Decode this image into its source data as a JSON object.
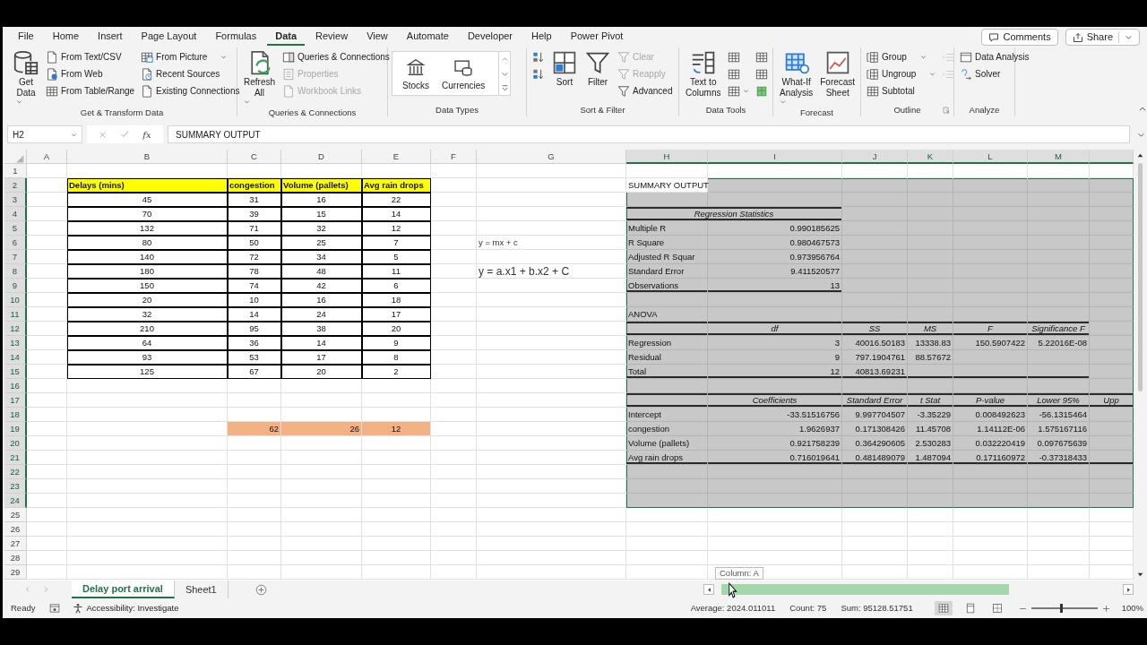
{
  "ribbon_tabs": [
    {
      "label": "File",
      "selected": false
    },
    {
      "label": "Home",
      "selected": false
    },
    {
      "label": "Insert",
      "selected": false
    },
    {
      "label": "Page Layout",
      "selected": false
    },
    {
      "label": "Formulas",
      "selected": false
    },
    {
      "label": "Data",
      "selected": true
    },
    {
      "label": "Review",
      "selected": false
    },
    {
      "label": "View",
      "selected": false
    },
    {
      "label": "Automate",
      "selected": false
    },
    {
      "label": "Developer",
      "selected": false
    },
    {
      "label": "Help",
      "selected": false
    },
    {
      "label": "Power Pivot",
      "selected": false
    }
  ],
  "header_buttons": [
    {
      "label": "Comments",
      "dropdown": false
    },
    {
      "label": "Share",
      "dropdown": true
    }
  ],
  "ribbon_groups": [
    {
      "label": "Get & Transform Data",
      "launcher": false,
      "columns": [
        {
          "kind": "large",
          "items": [
            {
              "label": "Get\nData",
              "disabled": false,
              "dropdown": true
            }
          ]
        },
        {
          "kind": "small",
          "items": [
            {
              "label": "From Text/CSV",
              "disabled": false,
              "dropdown": false
            },
            {
              "label": "From Web",
              "disabled": false,
              "dropdown": false
            },
            {
              "label": "From Table/Range",
              "disabled": false,
              "dropdown": false
            }
          ]
        },
        {
          "kind": "small",
          "items": [
            {
              "label": "From Picture",
              "disabled": false,
              "dropdown": true
            },
            {
              "label": "Recent Sources",
              "disabled": false,
              "dropdown": false
            },
            {
              "label": "Existing Connections",
              "disabled": false,
              "dropdown": false
            }
          ]
        }
      ]
    },
    {
      "label": "Queries & Connections",
      "launcher": false,
      "columns": [
        {
          "kind": "large",
          "items": [
            {
              "label": "Refresh\nAll",
              "disabled": false,
              "dropdown": true
            }
          ]
        },
        {
          "kind": "small",
          "items": [
            {
              "label": "Queries & Connections",
              "disabled": false,
              "dropdown": false
            },
            {
              "label": "Properties",
              "disabled": true,
              "dropdown": false
            },
            {
              "label": "Workbook Links",
              "disabled": true,
              "dropdown": false
            }
          ]
        }
      ]
    },
    {
      "label": "Data Types",
      "launcher": false,
      "columns": [
        {
          "kind": "gallery",
          "items": [
            {
              "label": "Stocks",
              "disabled": false,
              "dropdown": false
            },
            {
              "label": "Currencies",
              "disabled": false,
              "dropdown": false
            }
          ]
        }
      ]
    },
    {
      "label": "Sort & Filter",
      "launcher": false,
      "columns": [
        {
          "kind": "small",
          "items": [
            {
              "disabled": false,
              "dropdown": false
            },
            {
              "disabled": false,
              "dropdown": false
            }
          ]
        },
        {
          "kind": "large",
          "items": [
            {
              "label": "Sort",
              "disabled": false,
              "dropdown": false
            }
          ]
        },
        {
          "kind": "large",
          "items": [
            {
              "label": "Filter",
              "disabled": false,
              "dropdown": false
            }
          ]
        },
        {
          "kind": "small",
          "items": [
            {
              "label": "Clear",
              "disabled": true,
              "dropdown": false
            },
            {
              "label": "Reapply",
              "disabled": true,
              "dropdown": false
            },
            {
              "label": "Advanced",
              "disabled": false,
              "dropdown": false
            }
          ]
        }
      ]
    },
    {
      "label": "Data Tools",
      "launcher": false,
      "columns": [
        {
          "kind": "large",
          "items": [
            {
              "label": "Text to\nColumns",
              "disabled": false,
              "dropdown": false
            }
          ]
        },
        {
          "kind": "small",
          "items": [
            {
              "disabled": false,
              "dropdown": false
            },
            {
              "disabled": false,
              "dropdown": false
            },
            {
              "disabled": false,
              "dropdown": true
            }
          ]
        },
        {
          "kind": "small",
          "items": [
            {
              "disabled": false,
              "dropdown": false
            },
            {
              "disabled": false,
              "dropdown": false
            },
            {
              "disabled": false,
              "dropdown": false
            }
          ]
        }
      ]
    },
    {
      "label": "Forecast",
      "launcher": false,
      "columns": [
        {
          "kind": "large",
          "items": [
            {
              "label": "What-If\nAnalysis",
              "disabled": false,
              "dropdown": true
            },
            {
              "label": "Forecast\nSheet",
              "disabled": false,
              "dropdown": false
            }
          ]
        }
      ]
    },
    {
      "label": "Outline",
      "launcher": true,
      "columns": [
        {
          "kind": "small",
          "items": [
            {
              "label": "Group",
              "disabled": false,
              "dropdown": true
            },
            {
              "label": "Ungroup",
              "disabled": false,
              "dropdown": true
            },
            {
              "label": "Subtotal",
              "disabled": false,
              "dropdown": false
            }
          ]
        },
        {
          "kind": "small",
          "items": [
            {
              "disabled": true,
              "dropdown": false
            },
            {
              "disabled": true,
              "dropdown": false
            }
          ]
        }
      ]
    },
    {
      "label": "Analyze",
      "launcher": false,
      "columns": [
        {
          "kind": "small",
          "items": [
            {
              "label": "Data Analysis",
              "disabled": false,
              "dropdown": false
            },
            {
              "label": "Solver",
              "disabled": false,
              "dropdown": false
            }
          ]
        }
      ]
    }
  ],
  "formula_bar": {
    "name_box": "H2",
    "function_label": "fx",
    "formula": "SUMMARY OUTPUT"
  },
  "sheet": {
    "columns": [
      {
        "label": "A",
        "selected": false
      },
      {
        "label": "B",
        "selected": false
      },
      {
        "label": "C",
        "selected": false
      },
      {
        "label": "D",
        "selected": false
      },
      {
        "label": "E",
        "selected": false
      },
      {
        "label": "F",
        "selected": false
      },
      {
        "label": "G",
        "selected": false
      },
      {
        "label": "H",
        "selected": true
      },
      {
        "label": "I",
        "selected": true
      },
      {
        "label": "J",
        "selected": true
      },
      {
        "label": "K",
        "selected": true
      },
      {
        "label": "L",
        "selected": true
      },
      {
        "label": "M",
        "selected": true
      },
      {
        "selected": true
      }
    ],
    "rows": [
      {
        "number": "1",
        "selected": false
      },
      {
        "number": "2",
        "selected": true,
        "cells": [
          {},
          {
            "text": "Delays (mins)",
            "kind": "header"
          },
          {
            "text": "congestion",
            "kind": "header"
          },
          {
            "text": "Volume (pallets)",
            "kind": "header"
          },
          {
            "text": "Avg rain drops",
            "kind": "header"
          },
          {},
          {},
          {
            "text": "SUMMARY OUTPUT",
            "kind": "label"
          }
        ]
      },
      {
        "number": "3",
        "selected": true,
        "cells": [
          {},
          {
            "text": "45",
            "kind": "data"
          },
          {
            "text": "31",
            "kind": "data"
          },
          {
            "text": "16",
            "kind": "data"
          },
          {
            "text": "22",
            "kind": "data"
          }
        ]
      },
      {
        "number": "4",
        "selected": true,
        "cells": [
          {},
          {
            "text": "70",
            "kind": "data"
          },
          {
            "text": "39",
            "kind": "data"
          },
          {
            "text": "15",
            "kind": "data"
          },
          {
            "text": "14",
            "kind": "data"
          },
          {},
          {},
          {
            "text": "Regression Statistics",
            "kind": "heading-wide",
            "rule_top": true,
            "rule_bottom": true
          }
        ]
      },
      {
        "number": "5",
        "selected": true,
        "cells": [
          {},
          {
            "text": "132",
            "kind": "data"
          },
          {
            "text": "71",
            "kind": "data"
          },
          {
            "text": "32",
            "kind": "data"
          },
          {
            "text": "12",
            "kind": "data"
          },
          {},
          {},
          {
            "text": "Multiple R",
            "kind": "label"
          },
          {
            "text": "0.990185625",
            "kind": "number"
          }
        ]
      },
      {
        "number": "6",
        "selected": true,
        "cells": [
          {},
          {
            "text": "80",
            "kind": "data"
          },
          {
            "text": "50",
            "kind": "data"
          },
          {
            "text": "25",
            "kind": "data"
          },
          {
            "text": "7",
            "kind": "data"
          },
          {},
          {
            "text": "y = mx + c",
            "kind": "note"
          },
          {
            "text": "R Square",
            "kind": "label"
          },
          {
            "text": "0.980467573",
            "kind": "number"
          }
        ]
      },
      {
        "number": "7",
        "selected": true,
        "cells": [
          {},
          {
            "text": "140",
            "kind": "data"
          },
          {
            "text": "72",
            "kind": "data"
          },
          {
            "text": "34",
            "kind": "data"
          },
          {
            "text": "5",
            "kind": "data"
          },
          {},
          {},
          {
            "text": "Adjusted R Squar",
            "kind": "label"
          },
          {
            "text": "0.973956764",
            "kind": "number"
          }
        ]
      },
      {
        "number": "8",
        "selected": true,
        "cells": [
          {},
          {
            "text": "180",
            "kind": "data"
          },
          {
            "text": "78",
            "kind": "data"
          },
          {
            "text": "48",
            "kind": "data"
          },
          {
            "text": "11",
            "kind": "data"
          },
          {},
          {
            "text": "y = a.x1 + b.x2 + C",
            "kind": "note-large"
          },
          {
            "text": "Standard Error",
            "kind": "label"
          },
          {
            "text": "9.411520577",
            "kind": "number"
          }
        ]
      },
      {
        "number": "9",
        "selected": true,
        "cells": [
          {},
          {
            "text": "150",
            "kind": "data"
          },
          {
            "text": "74",
            "kind": "data"
          },
          {
            "text": "42",
            "kind": "data"
          },
          {
            "text": "6",
            "kind": "data"
          },
          {},
          {},
          {
            "text": "Observations",
            "kind": "label",
            "rule_bottom": true
          },
          {
            "text": "13",
            "kind": "number",
            "rule_bottom": true
          }
        ]
      },
      {
        "number": "10",
        "selected": true,
        "cells": [
          {},
          {
            "text": "20",
            "kind": "data"
          },
          {
            "text": "10",
            "kind": "data"
          },
          {
            "text": "16",
            "kind": "data"
          },
          {
            "text": "18",
            "kind": "data"
          }
        ]
      },
      {
        "number": "11",
        "selected": true,
        "cells": [
          {},
          {
            "text": "32",
            "kind": "data"
          },
          {
            "text": "14",
            "kind": "data"
          },
          {
            "text": "24",
            "kind": "data"
          },
          {
            "text": "17",
            "kind": "data"
          },
          {},
          {},
          {
            "text": "ANOVA",
            "kind": "label"
          }
        ]
      },
      {
        "number": "12",
        "selected": true,
        "cells": [
          {},
          {
            "text": "210",
            "kind": "data"
          },
          {
            "text": "95",
            "kind": "data"
          },
          {
            "text": "38",
            "kind": "data"
          },
          {
            "text": "20",
            "kind": "data"
          },
          {},
          {},
          {
            "kind": "label",
            "rule_top": true,
            "rule_bottom": true
          },
          {
            "text": "df",
            "kind": "heading",
            "rule_top": true,
            "rule_bottom": true
          },
          {
            "text": "SS",
            "kind": "heading",
            "rule_top": true,
            "rule_bottom": true
          },
          {
            "text": "MS",
            "kind": "heading",
            "rule_top": true,
            "rule_bottom": true
          },
          {
            "text": "F",
            "kind": "heading",
            "rule_top": true,
            "rule_bottom": true
          },
          {
            "text": "Significance F",
            "kind": "heading",
            "rule_top": true,
            "rule_bottom": true
          }
        ]
      },
      {
        "number": "13",
        "selected": true,
        "cells": [
          {},
          {
            "text": "64",
            "kind": "data"
          },
          {
            "text": "36",
            "kind": "data"
          },
          {
            "text": "14",
            "kind": "data"
          },
          {
            "text": "9",
            "kind": "data"
          },
          {},
          {},
          {
            "text": "Regression",
            "kind": "label"
          },
          {
            "text": "3",
            "kind": "number"
          },
          {
            "text": "40016.50183",
            "kind": "number"
          },
          {
            "text": "13338.83",
            "kind": "number"
          },
          {
            "text": "150.5907422",
            "kind": "number"
          },
          {
            "text": "5.22016E-08",
            "kind": "number"
          }
        ]
      },
      {
        "number": "14",
        "selected": true,
        "cells": [
          {},
          {
            "text": "93",
            "kind": "data"
          },
          {
            "text": "53",
            "kind": "data"
          },
          {
            "text": "17",
            "kind": "data"
          },
          {
            "text": "8",
            "kind": "data"
          },
          {},
          {},
          {
            "text": "Residual",
            "kind": "label"
          },
          {
            "text": "9",
            "kind": "number"
          },
          {
            "text": "797.1904761",
            "kind": "number"
          },
          {
            "text": "88.57672",
            "kind": "number"
          }
        ]
      },
      {
        "number": "15",
        "selected": true,
        "cells": [
          {},
          {
            "text": "125",
            "kind": "data"
          },
          {
            "text": "67",
            "kind": "data"
          },
          {
            "text": "20",
            "kind": "data"
          },
          {
            "text": "2",
            "kind": "data"
          },
          {},
          {},
          {
            "text": "Total",
            "kind": "label",
            "rule_bottom": true
          },
          {
            "text": "12",
            "kind": "number",
            "rule_bottom": true
          },
          {
            "text": "40813.69231",
            "kind": "number",
            "rule_bottom": true
          },
          {
            "kind": "number",
            "rule_bottom": true
          },
          {
            "kind": "number",
            "rule_bottom": true
          },
          {
            "kind": "number",
            "rule_bottom": true
          }
        ]
      },
      {
        "number": "16",
        "selected": true
      },
      {
        "number": "17",
        "selected": true,
        "cells": [
          {},
          {},
          {},
          {},
          {},
          {},
          {},
          {
            "kind": "label",
            "rule_top": true,
            "rule_bottom": true
          },
          {
            "text": "Coefficients",
            "kind": "heading",
            "rule_top": true,
            "rule_bottom": true
          },
          {
            "text": "Standard Error",
            "kind": "heading",
            "rule_top": true,
            "rule_bottom": true
          },
          {
            "text": "t Stat",
            "kind": "heading",
            "rule_top": true,
            "rule_bottom": true
          },
          {
            "text": "P-value",
            "kind": "heading",
            "rule_top": true,
            "rule_bottom": true
          },
          {
            "text": "Lower 95%",
            "kind": "heading",
            "rule_top": true,
            "rule_bottom": true
          },
          {
            "text": "Upp",
            "kind": "heading",
            "rule_top": true,
            "rule_bottom": true
          }
        ]
      },
      {
        "number": "18",
        "selected": true,
        "cells": [
          {},
          {},
          {},
          {},
          {},
          {},
          {},
          {
            "text": "Intercept",
            "kind": "label"
          },
          {
            "text": "-33.51516756",
            "kind": "number"
          },
          {
            "text": "9.997704507",
            "kind": "number"
          },
          {
            "text": "-3.35229",
            "kind": "number"
          },
          {
            "text": "0.008492623",
            "kind": "number"
          },
          {
            "text": "-56.1315464",
            "kind": "number"
          }
        ]
      },
      {
        "number": "19",
        "selected": true,
        "cells": [
          {},
          {},
          {
            "text": "62",
            "kind": "highlight"
          },
          {
            "text": "26",
            "kind": "highlight"
          },
          {
            "text": "12",
            "kind": "highlight-center"
          },
          {},
          {},
          {
            "text": "congestion",
            "kind": "label"
          },
          {
            "text": "1.9626937",
            "kind": "number"
          },
          {
            "text": "0.171308426",
            "kind": "number"
          },
          {
            "text": "11.45708",
            "kind": "number"
          },
          {
            "text": "1.14112E-06",
            "kind": "number"
          },
          {
            "text": "1.575167116",
            "kind": "number"
          }
        ]
      },
      {
        "number": "20",
        "selected": true,
        "cells": [
          {},
          {},
          {},
          {},
          {},
          {},
          {},
          {
            "text": "Volume (pallets)",
            "kind": "label"
          },
          {
            "text": "0.921758239",
            "kind": "number"
          },
          {
            "text": "0.364290605",
            "kind": "number"
          },
          {
            "text": "2.530283",
            "kind": "number"
          },
          {
            "text": "0.032220419",
            "kind": "number"
          },
          {
            "text": "0.097675639",
            "kind": "number"
          }
        ]
      },
      {
        "number": "21",
        "selected": true,
        "cells": [
          {},
          {},
          {},
          {},
          {},
          {},
          {},
          {
            "text": "Avg rain drops",
            "kind": "label",
            "rule_bottom": true
          },
          {
            "text": "0.716019641",
            "kind": "number",
            "rule_bottom": true
          },
          {
            "text": "0.481489079",
            "kind": "number",
            "rule_bottom": true
          },
          {
            "text": "1.487094",
            "kind": "number",
            "rule_bottom": true
          },
          {
            "text": "0.171160972",
            "kind": "number",
            "rule_bottom": true
          },
          {
            "text": "-0.37318433",
            "kind": "number",
            "rule_bottom": true
          },
          {
            "kind": "number",
            "rule_bottom": true
          }
        ]
      },
      {
        "number": "22",
        "selected": true
      },
      {
        "number": "23",
        "selected": true
      },
      {
        "number": "24",
        "selected": true
      },
      {
        "number": "25",
        "selected": false
      },
      {
        "number": "26",
        "selected": false
      },
      {
        "number": "27",
        "selected": false
      },
      {
        "number": "28",
        "selected": false
      },
      {
        "number": "29",
        "selected": false
      }
    ]
  },
  "tooltip": "Column: A",
  "sheet_tabs": [
    {
      "label": "Delay port arrival",
      "selected": true
    },
    {
      "label": "Sheet1",
      "selected": false
    }
  ],
  "status_bar": {
    "mode": "Ready",
    "accessibility": "Accessibility: Investigate",
    "stats": [
      "Average: 2024.011011",
      "Count: 75",
      "Sum: 95128.51751"
    ],
    "views": [
      {
        "kind": "normal",
        "selected": true
      },
      {
        "kind": "page-layout",
        "selected": false
      },
      {
        "kind": "page-break",
        "selected": false
      }
    ],
    "zoom": {
      "level": 0.45,
      "reading": "100%"
    }
  }
}
